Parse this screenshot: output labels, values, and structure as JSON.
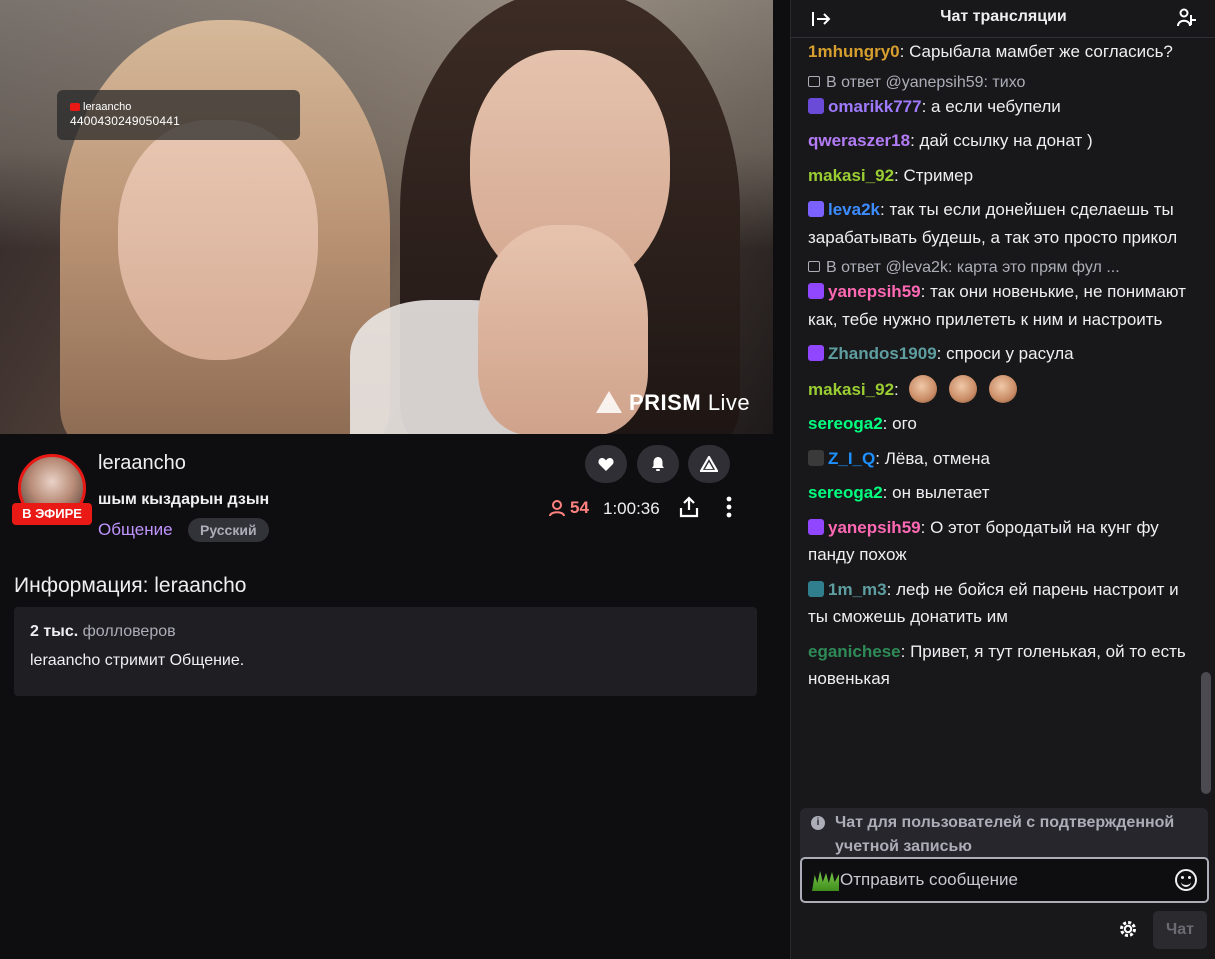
{
  "video": {
    "overlay_user": "leraancho",
    "overlay_id": "4400430249050441",
    "watermark_brand": "PRISM",
    "watermark_live": "Live"
  },
  "channel": {
    "streamer": "leraancho",
    "live_badge": "В ЭФИРЕ",
    "stream_title": "шым кыздарын дзын",
    "category": "Общение",
    "language_tag": "Русский",
    "viewers": "54",
    "uptime": "1:00:36"
  },
  "about": {
    "title": "Информация: leraancho",
    "followers_count": "2 тыс.",
    "followers_label": "фолловеров",
    "description": "leraancho стримит Общение."
  },
  "chat": {
    "header_title": "Чат трансляции",
    "messages": [
      {
        "user": "1mhungry0",
        "color": "#d79f2e",
        "text": "Сарыбала мамбет же согласись?"
      },
      {
        "reply_to": "В ответ @yanepsih59: тихо",
        "user": "omarikk777",
        "color": "#9f7aff",
        "text": "а если чебупели"
      },
      {
        "user": "qweraszer18",
        "color": "#b37cf6",
        "text": "дай ссылку на донат )"
      },
      {
        "user": "makasi_92",
        "color": "#9acd32",
        "text": "Стример"
      },
      {
        "user": "leva2k",
        "color": "#3d8cff",
        "text": "так ты если донейшен сделаешь ты зарабатывать будешь, а так это просто прикол"
      },
      {
        "reply_to": "В ответ @leva2k: карта это прям фул ...",
        "user": "yanepsih59",
        "color": "#ff69b4",
        "text": "так они новенькие, не понимают как, тебе нужно прилететь к ним и настроить"
      },
      {
        "user": "Zhandos1909",
        "color": "#5f9ea0",
        "text": "спроси у расула"
      },
      {
        "user": "makasi_92",
        "color": "#9acd32",
        "text": ""
      },
      {
        "user": "sereoga2",
        "color": "#00ff7f",
        "text": "ого"
      },
      {
        "user": "Z_I_Q",
        "color": "#1e90ff",
        "text": "Лёва, отмена"
      },
      {
        "user": "sereoga2",
        "color": "#00ff7f",
        "text": "он вылетает"
      },
      {
        "user": "yanepsih59",
        "color": "#ff69b4",
        "text": "О этот бородатый на кунг фу панду похож"
      },
      {
        "user": "1m_m3",
        "color": "#5f9ea0",
        "text": "леф не бойся ей парень настроит и ты сможешь донатить им"
      },
      {
        "user": "eganichese",
        "color": "#2e8b57",
        "text": "Привет, я тут голенькая, ой то есть новенькая"
      }
    ],
    "notice": "Чат для пользователей с подтвержденной учетной записью",
    "input_placeholder": "Отправить сообщение",
    "send_label": "Чат"
  }
}
